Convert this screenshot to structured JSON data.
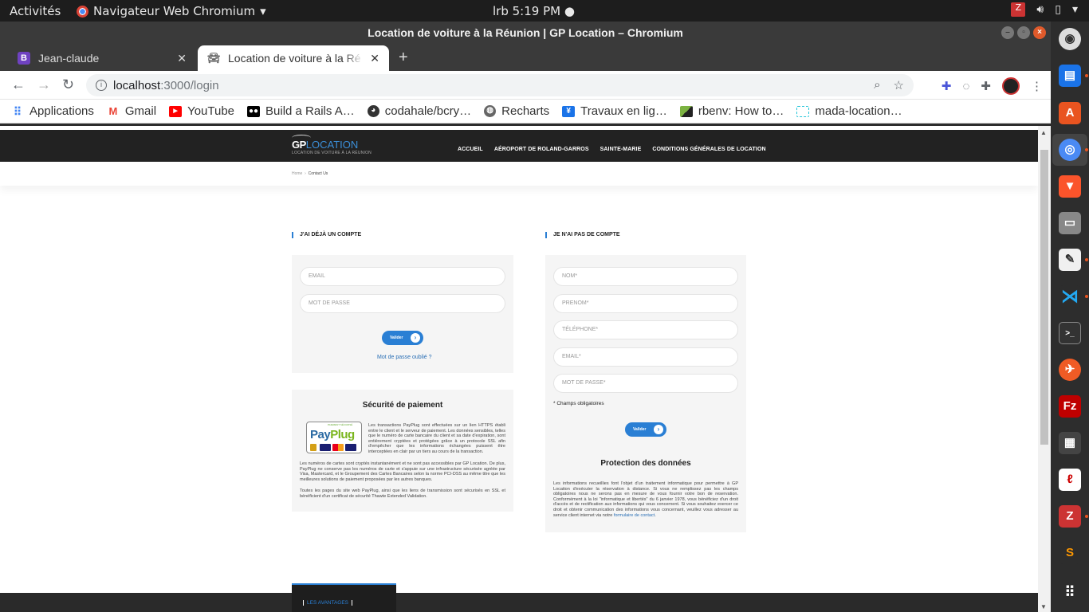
{
  "desktop": {
    "activities": "Activités",
    "app_name": "Navigateur Web Chromium",
    "clock": "lrb   5:19 PM",
    "dock_apps": [
      "settings-app",
      "text-editor-app",
      "software-center-app",
      "chromium-app",
      "brave-app",
      "files-app",
      "notes-app",
      "vscode-app",
      "terminal-app",
      "postman-app",
      "filezilla-app",
      "video-editor-app",
      "pdf-reader-app",
      "zotero-app",
      "sublime-text-app",
      "show-apps"
    ]
  },
  "window": {
    "title": "Location de voiture à la Réunion | GP Location – Chromium"
  },
  "tabs": [
    {
      "label": "Jean-claude",
      "icon": "bootstrap-b-icon"
    },
    {
      "label": "Location de voiture à la Ré",
      "icon": "car-icon"
    }
  ],
  "address_bar": {
    "host": "localhost",
    "path": ":3000/login"
  },
  "bookmarks": [
    {
      "label": "Applications",
      "icon": "apps-grid-icon",
      "color": "#4285f4"
    },
    {
      "label": "Gmail",
      "icon": "gmail-icon",
      "color": "#ea4335"
    },
    {
      "label": "YouTube",
      "icon": "youtube-icon",
      "color": "#ff0000"
    },
    {
      "label": "Build a Rails A…",
      "icon": "medium-icon",
      "color": "#000000"
    },
    {
      "label": "codahale/bcry…",
      "icon": "github-icon",
      "color": "#333333"
    },
    {
      "label": "Recharts",
      "icon": "globe-icon",
      "color": "#555555"
    },
    {
      "label": "Travaux en lig…",
      "icon": "book-icon",
      "color": "#1a73e8"
    },
    {
      "label": "rbenv: How to…",
      "icon": "rbenv-icon",
      "color": "#7cb342"
    },
    {
      "label": "mada-location…",
      "icon": "page-icon",
      "color": "#26c6da"
    }
  ],
  "site": {
    "logo_gp": "GP",
    "logo_location": "LOCATION",
    "logo_tagline": "LOCATION DE VOITURE À LA RÉUNION",
    "menu": [
      "ACCUEIL",
      "AÉROPORT DE ROLAND-GARROS",
      "SAINTE-MARIE",
      "CONDITIONS GÉNÉRALES DE LOCATION"
    ],
    "breadcrumb": {
      "home": "Home",
      "sep": "›",
      "current": "Contact Us"
    },
    "login": {
      "title": "J'AI DÉJÀ UN COMPTE",
      "email_placeholder": "EMAIL",
      "password_placeholder": "MOT DE PASSE",
      "submit": "Valider",
      "forgot": "Mot de passe oublié ?"
    },
    "security": {
      "title": "Sécurité de paiement",
      "logo_top": "PAIEMENT SÉCURISÉ",
      "logo_pay": "Pay",
      "logo_plug": "Plug",
      "text": "Les transactions PayPlug sont effectuées sur un lien HTTPS établi entre le client et le serveur de paiement. Les données sensibles, telles que le numéro de carte bancaire du client et sa date d'expiration, sont entièrement cryptées et protégées grâce à un protocole SSL afin d'empêcher que les informations échangées puissent être interceptées en clair par un tiers au cours de la transaction.",
      "text2": "Les numéros de cartes sont cryptés instantanément et ne sont pas accessibles par GP Location. De plus, PayPlug ne conserve pas les numéros de carte et s'appuie sur une infrastructure sécurisée agréée par Visa, Mastercard, et le Groupement des Cartes Bancaires selon la norme PCI-DSS au même titre que les meilleures solutions de paiement proposées par les autres banques.",
      "text3": "Toutes les pages du site web PayPlug, ainsi que les liens de transmission sont sécurisés en SSL et bénéficient d'un certificat de sécurité Thawte Extended Validation."
    },
    "register": {
      "title": "JE N'AI PAS DE COMPTE",
      "nom": "NOM*",
      "prenom": "PRENOM*",
      "telephone": "TÉLÉPHONE*",
      "email": "EMAIL*",
      "password": "MOT DE PASSE*",
      "required_note": "* Champs obligatoires",
      "submit": "Valider"
    },
    "privacy": {
      "title": "Protection des données",
      "text": "Les informations recueillies font l'objet d'un traitement informatique pour permettre à GP Location d'exécuter la réservation à distance. Si vous ne remplissez pas les champs obligatoires nous ne serons pas en mesure de vous fournir votre bon de reservation. Conformément à la loi \"informatique et libertés\" du 6 janvier 1978, vous bénéficiez d'un droit d'accès et de rectification aux informations qui vous concernent. Si vous souhaitez exercer ce droit et obtenir communication des informations vous concernant, veuillez vous adresser au service client internet via notre",
      "link": "formulaire de contact",
      "end": "."
    },
    "footer_tab": "LES AVANTAGES"
  }
}
